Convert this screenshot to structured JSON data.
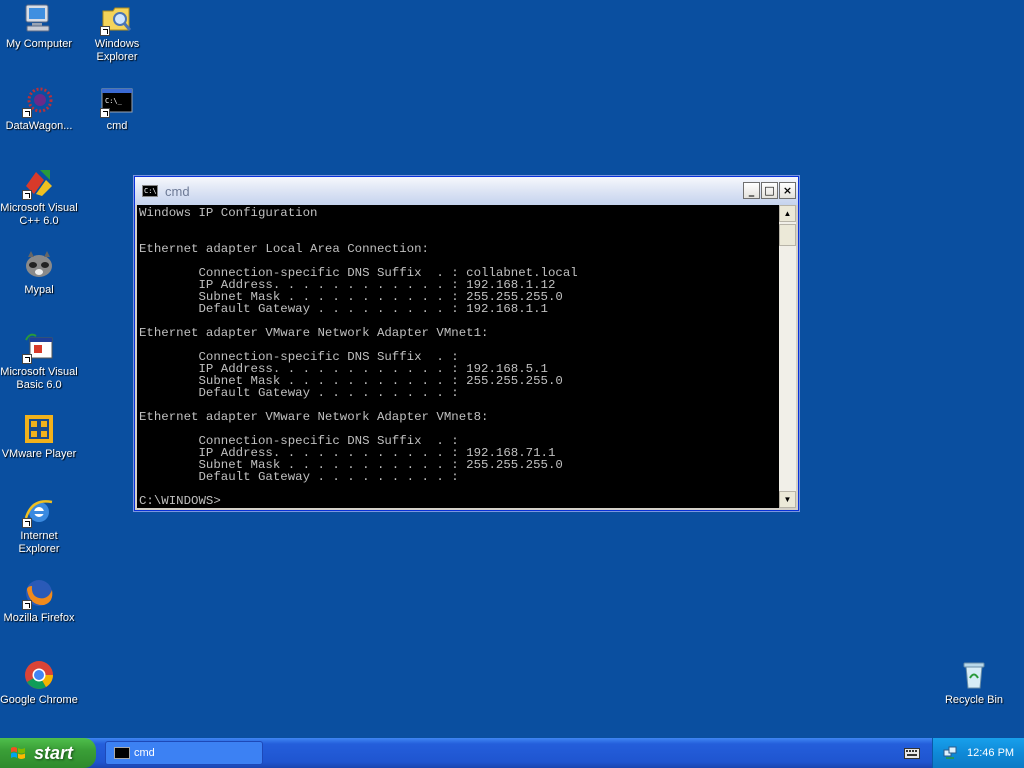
{
  "desktop": {
    "icons": [
      {
        "label": "My Computer"
      },
      {
        "label": "Windows Explorer"
      },
      {
        "label": "DataWagon..."
      },
      {
        "label": "cmd"
      },
      {
        "label": "Microsoft Visual C++ 6.0"
      },
      {
        "label": "Mypal"
      },
      {
        "label": "Microsoft Visual Basic 6.0"
      },
      {
        "label": "VMware Player"
      },
      {
        "label": "Internet Explorer"
      },
      {
        "label": "Mozilla Firefox"
      },
      {
        "label": "Google Chrome"
      },
      {
        "label": "Recycle Bin"
      }
    ]
  },
  "cmd_window": {
    "title": "cmd",
    "icon_text": "C:\\",
    "minimize_label": "_",
    "maximize_label": "□",
    "close_label": "×",
    "console_lines": [
      "Windows IP Configuration",
      "",
      "",
      "Ethernet adapter Local Area Connection:",
      "",
      "        Connection-specific DNS Suffix  . : collabnet.local",
      "        IP Address. . . . . . . . . . . . : 192.168.1.12",
      "        Subnet Mask . . . . . . . . . . . : 255.255.255.0",
      "        Default Gateway . . . . . . . . . : 192.168.1.1",
      "",
      "Ethernet adapter VMware Network Adapter VMnet1:",
      "",
      "        Connection-specific DNS Suffix  . :",
      "        IP Address. . . . . . . . . . . . : 192.168.5.1",
      "        Subnet Mask . . . . . . . . . . . : 255.255.255.0",
      "        Default Gateway . . . . . . . . . :",
      "",
      "Ethernet adapter VMware Network Adapter VMnet8:",
      "",
      "        Connection-specific DNS Suffix  . :",
      "        IP Address. . . . . . . . . . . . : 192.168.71.1",
      "        Subnet Mask . . . . . . . . . . . : 255.255.255.0",
      "        Default Gateway . . . . . . . . . :",
      "",
      "C:\\WINDOWS>"
    ],
    "scroll_up": "▲",
    "scroll_down": "▼"
  },
  "taskbar": {
    "start_label": "start",
    "tasks": [
      {
        "label": "cmd"
      }
    ],
    "clock": "12:46 PM"
  },
  "colors": {
    "desktop_bg": "#0a4fa0",
    "taskbar_blue": "#245edb",
    "start_green": "#3a9f37",
    "tray_blue": "#0f8ad8"
  }
}
